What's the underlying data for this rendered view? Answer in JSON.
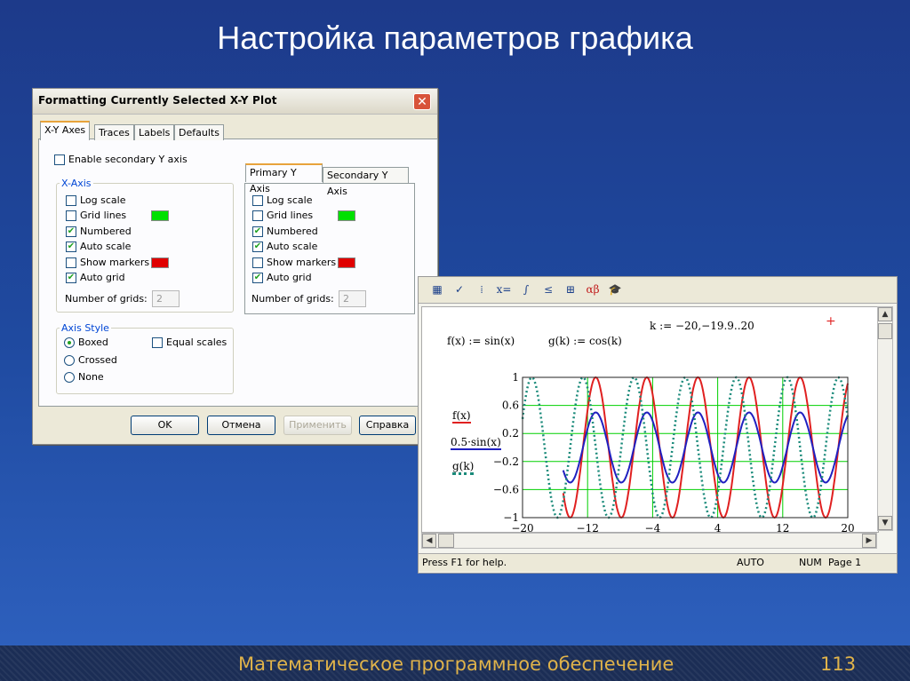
{
  "slide": {
    "title": "Настройка параметров графика",
    "footer": "Математическое программное обеспечение",
    "page_number": "113"
  },
  "dialog": {
    "title": "Formatting Currently Selected X-Y Plot",
    "tabs": [
      "X-Y Axes",
      "Traces",
      "Labels",
      "Defaults"
    ],
    "enable_secondary": {
      "label": "Enable secondary Y axis",
      "checked": false
    },
    "x_axis": {
      "group_title": "X-Axis",
      "options": [
        {
          "label": "Log scale",
          "checked": false
        },
        {
          "label": "Grid lines",
          "checked": false,
          "color": "#00e000"
        },
        {
          "label": "Numbered",
          "checked": true
        },
        {
          "label": "Auto scale",
          "checked": true
        },
        {
          "label": "Show markers",
          "checked": false,
          "color": "#e00000"
        },
        {
          "label": "Auto grid",
          "checked": true
        }
      ],
      "grids_label": "Number of grids:",
      "grids_value": "2"
    },
    "y_axis": {
      "tabs": [
        "Primary Y Axis",
        "Secondary Y Axis"
      ],
      "options": [
        {
          "label": "Log scale",
          "checked": false
        },
        {
          "label": "Grid lines",
          "checked": false,
          "color": "#00e000"
        },
        {
          "label": "Numbered",
          "checked": true
        },
        {
          "label": "Auto scale",
          "checked": true
        },
        {
          "label": "Show markers",
          "checked": false,
          "color": "#e00000"
        },
        {
          "label": "Auto grid",
          "checked": true
        }
      ],
      "grids_label": "Number of grids:",
      "grids_value": "2"
    },
    "axis_style": {
      "group_title": "Axis Style",
      "options": [
        {
          "label": "Boxed",
          "selected": true
        },
        {
          "label": "Crossed",
          "selected": false
        },
        {
          "label": "None",
          "selected": false
        }
      ],
      "equal_scales": {
        "label": "Equal scales",
        "checked": false
      }
    },
    "buttons": {
      "ok": "OK",
      "cancel": "Отмена",
      "apply": "Применить",
      "help": "Справка"
    }
  },
  "mathcad": {
    "toolbar_icons": [
      "calculator-icon",
      "graph-icon",
      "matrix-icon",
      "evaluation-icon",
      "calculus-icon",
      "boolean-icon",
      "programming-icon",
      "greek-icon",
      "symbolic-icon"
    ],
    "toolbar_glyphs": [
      "▦",
      "✓",
      "⁞",
      "x=",
      "∫",
      "≤",
      "⊞",
      "αβ",
      "🎓"
    ],
    "range_def": "k := −20,−19.9..20",
    "f_def": "f(x) := sin(x)",
    "g_def": "g(k) := cos(k)",
    "legend": [
      "f(x)",
      "0.5·sin(x)",
      "g(k)"
    ],
    "status": {
      "help": "Press F1 for help.",
      "mode": "AUTO",
      "num": "NUM",
      "page": "Page 1"
    }
  },
  "chart_data": {
    "type": "line",
    "x_range": [
      -20,
      20
    ],
    "ylim": [
      -1,
      1
    ],
    "xticks": [
      "−20",
      "−12",
      "−4",
      "4",
      "12",
      "20"
    ],
    "yticks": [
      "1",
      "0.6",
      "0.2",
      "−0.2",
      "−0.6",
      "−1"
    ],
    "grid": true,
    "series": [
      {
        "name": "f(x)",
        "formula": "sin(x)",
        "x_start": -15,
        "x_end": 20,
        "color": "#e02020",
        "style": "solid"
      },
      {
        "name": "0.5·sin(x)",
        "formula": "0.5·sin(x)",
        "x_start": -15,
        "x_end": 20,
        "color": "#2020c0",
        "style": "solid"
      },
      {
        "name": "g(k)",
        "formula": "cos(k)",
        "x_start": -20,
        "x_end": 20,
        "color": "#1a8a7a",
        "style": "dotted"
      }
    ]
  }
}
